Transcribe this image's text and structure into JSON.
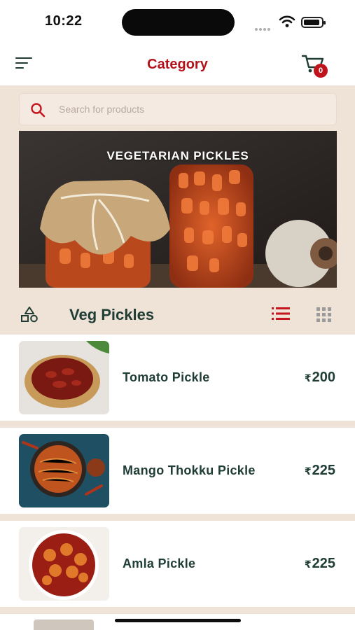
{
  "status_bar": {
    "time": "10:22"
  },
  "header": {
    "title": "Category",
    "cart_count": "0"
  },
  "search": {
    "placeholder": "Search for products"
  },
  "banner": {
    "title": "VEGETARIAN PICKLES"
  },
  "section": {
    "title": "Veg Pickles"
  },
  "products": [
    {
      "name": "Tomato Pickle",
      "currency": "₹",
      "price": "200"
    },
    {
      "name": "Mango Thokku Pickle",
      "currency": "₹",
      "price": "225"
    },
    {
      "name": "Amla Pickle",
      "currency": "₹",
      "price": "225"
    }
  ],
  "colors": {
    "accent": "#b3121a",
    "primary_text": "#1f3d35",
    "background": "#efe2d6"
  },
  "icons": [
    "menu-icon",
    "cart-icon",
    "search-icon",
    "category-icon",
    "list-view-icon",
    "grid-view-icon"
  ]
}
